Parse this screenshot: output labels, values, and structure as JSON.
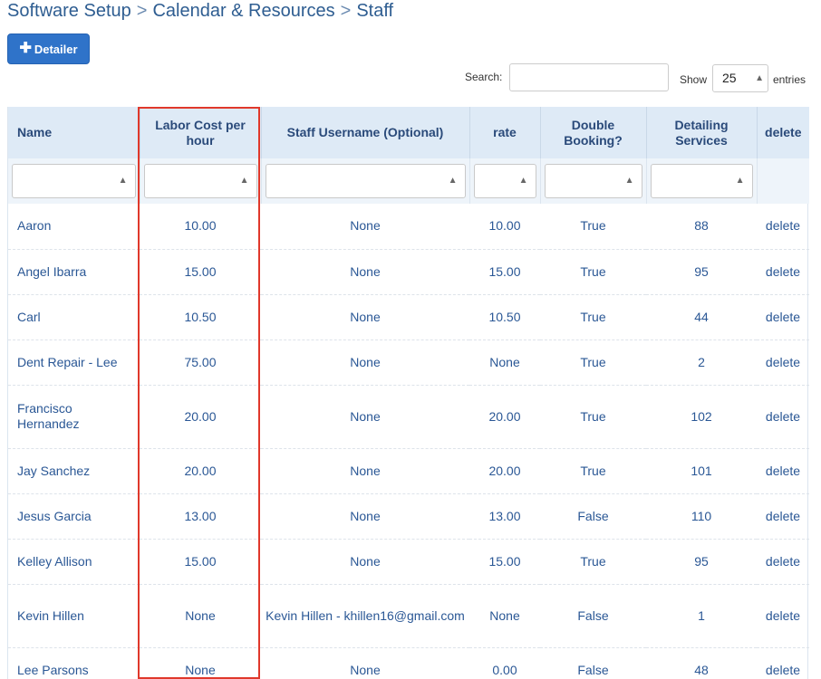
{
  "breadcrumb": {
    "items": [
      "Software Setup",
      "Calendar & Resources",
      "Staff"
    ],
    "separator": ">"
  },
  "toolbar": {
    "detailer_button_label": "Detailer",
    "detailer_button_icon": "plus-icon"
  },
  "search": {
    "label": "Search:",
    "value": ""
  },
  "page_length": {
    "show_label": "Show",
    "selected": "25",
    "entries_label": "entries"
  },
  "table": {
    "columns": [
      "Name",
      "Labor Cost per hour",
      "Staff Username (Optional)",
      "rate",
      "Double Booking?",
      "Detailing Services",
      "delete"
    ],
    "rows": [
      {
        "name": "Aaron",
        "labor_cost": "10.00",
        "username": "None",
        "rate": "10.00",
        "double_booking": "True",
        "detailing": "88",
        "delete": "delete"
      },
      {
        "name": "Angel Ibarra",
        "labor_cost": "15.00",
        "username": "None",
        "rate": "15.00",
        "double_booking": "True",
        "detailing": "95",
        "delete": "delete"
      },
      {
        "name": "Carl",
        "labor_cost": "10.50",
        "username": "None",
        "rate": "10.50",
        "double_booking": "True",
        "detailing": "44",
        "delete": "delete"
      },
      {
        "name": "Dent Repair - Lee",
        "labor_cost": "75.00",
        "username": "None",
        "rate": "None",
        "double_booking": "True",
        "detailing": "2",
        "delete": "delete"
      },
      {
        "name": "Francisco Hernandez",
        "labor_cost": "20.00",
        "username": "None",
        "rate": "20.00",
        "double_booking": "True",
        "detailing": "102",
        "delete": "delete"
      },
      {
        "name": "Jay Sanchez",
        "labor_cost": "20.00",
        "username": "None",
        "rate": "20.00",
        "double_booking": "True",
        "detailing": "101",
        "delete": "delete"
      },
      {
        "name": "Jesus Garcia",
        "labor_cost": "13.00",
        "username": "None",
        "rate": "13.00",
        "double_booking": "False",
        "detailing": "110",
        "delete": "delete"
      },
      {
        "name": "Kelley Allison",
        "labor_cost": "15.00",
        "username": "None",
        "rate": "15.00",
        "double_booking": "True",
        "detailing": "95",
        "delete": "delete"
      },
      {
        "name": "Kevin Hillen",
        "labor_cost": "None",
        "username": "Kevin Hillen - khillen16@gmail.com",
        "rate": "None",
        "double_booking": "False",
        "detailing": "1",
        "delete": "delete"
      },
      {
        "name": "Lee Parsons",
        "labor_cost": "None",
        "username": "None",
        "rate": "0.00",
        "double_booking": "False",
        "detailing": "48",
        "delete": "delete"
      }
    ]
  },
  "colors": {
    "brand_blue": "#2f73c9",
    "header_bg": "#deeaf6",
    "highlight_red": "#e0382b",
    "link_text": "#2a5795"
  }
}
